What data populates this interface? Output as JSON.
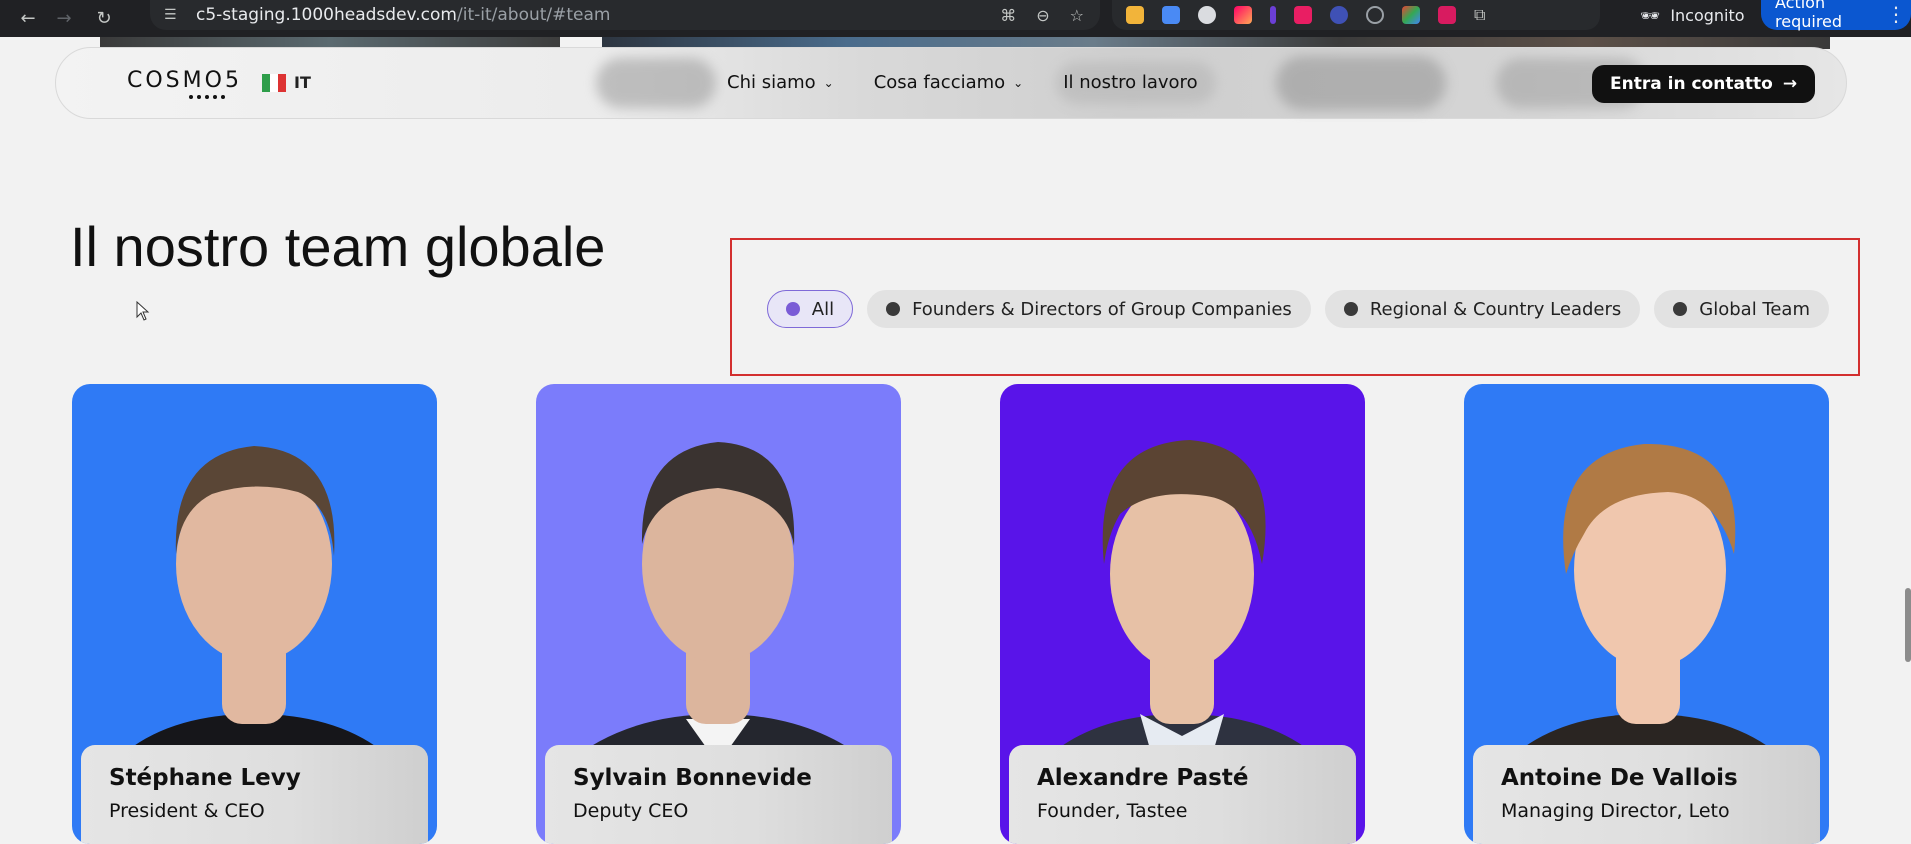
{
  "browser": {
    "url_host": "c5-staging.1000headsdev.com",
    "url_path": "/it-it/about/#team",
    "incognito_label": "Incognito",
    "action_label": "Action required",
    "icons": [
      "back-arrow-icon",
      "forward-arrow-icon",
      "reload-icon",
      "site-info-icon",
      "translate-icon",
      "zoom-icon",
      "bookmark-star-icon",
      "extensions-icon",
      "incognito-icon",
      "more-vert-icon"
    ]
  },
  "header": {
    "logo_text": "COSMO5",
    "language": "IT",
    "nav": [
      {
        "label": "Chi siamo",
        "has_menu": true
      },
      {
        "label": "Cosa facciamo",
        "has_menu": true
      },
      {
        "label": "Il nostro lavoro",
        "has_menu": false
      }
    ],
    "cta_label": "Entra in contatto",
    "cta_icon": "→"
  },
  "section": {
    "title": "Il nostro team globale",
    "filters": [
      {
        "label": "All",
        "active": true
      },
      {
        "label": "Founders & Directors of Group Companies",
        "active": false
      },
      {
        "label": "Regional & Country Leaders",
        "active": false
      },
      {
        "label": "Global Team",
        "active": false
      }
    ]
  },
  "team": [
    {
      "name": "Stéphane Levy",
      "role": "President & CEO",
      "bg": "#2f7af5",
      "hair": "#5a4636",
      "skin": "#e1b8a0",
      "shirt": "#16161a"
    },
    {
      "name": "Sylvain Bonnevide",
      "role": "Deputy CEO",
      "bg": "#7b7cfb",
      "hair": "#3a3330",
      "skin": "#dcb59d",
      "shirt": "#24262e"
    },
    {
      "name": "Alexandre Pasté",
      "role": "Founder, Tastee",
      "bg": "#5914e9",
      "hair": "#5b4433",
      "skin": "#e7c1a6",
      "shirt": "#2e3240"
    },
    {
      "name": "Antoine De Vallois",
      "role": "Managing Director, Leto",
      "bg": "#2f7af5",
      "hair": "#b07a45",
      "skin": "#f0c7ae",
      "shirt": "#2a2522"
    }
  ],
  "colors": {
    "filter_active_dot": "#7a5cd6",
    "highlight_border": "#d32f2f",
    "cta_bg": "#111111"
  }
}
